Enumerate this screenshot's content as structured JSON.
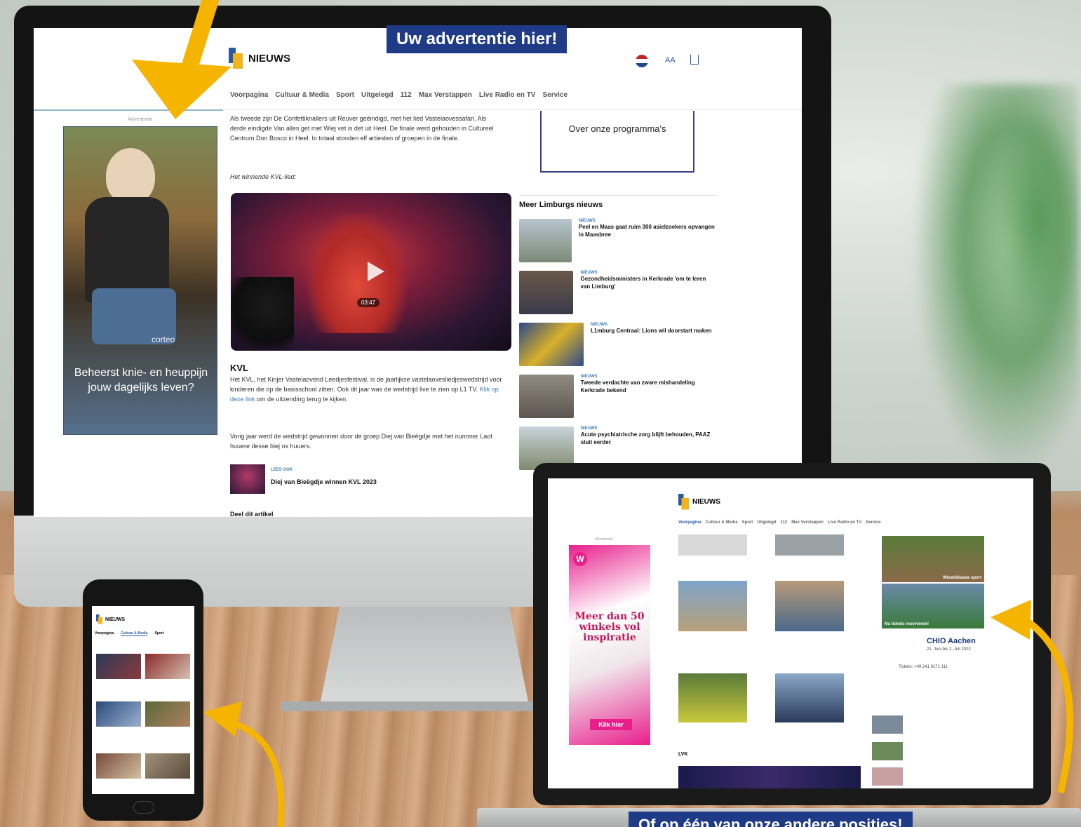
{
  "colors": {
    "accent_yellow": "#f5b400",
    "banner_blue": "#1f3a86",
    "logo_blue": "#2a58a6",
    "logo_yellow": "#f2b31b",
    "link_blue": "#3a7ab8"
  },
  "top_banner": {
    "label": "Uw advertentie hier!"
  },
  "bottom_banner": {
    "label": "Of op één van onze andere posities!"
  },
  "desktop": {
    "logo": "NIEUWS",
    "header_icons": [
      "flag-nl-icon",
      "text-size-icon",
      "share-icon"
    ],
    "text_size_label": "AA",
    "nav": [
      "Voorpagina",
      "Cultuur & Media",
      "Sport",
      "Uitgelegd",
      "112",
      "Max Verstappen",
      "Live Radio en TV",
      "Service"
    ],
    "ad_label": "Advertentie",
    "skyscraper": {
      "brand": "corteo",
      "headline": "Beheerst knie- en heuppijn jouw dagelijks leven?"
    },
    "article": {
      "para1": "Als tweede zijn De Confettiknallers uit Reuver geëindigd, met het lied Vastelaovessafari. Als derde eindigde Van alles get met Wiej vet is det uit Heel. De finale werd gehouden in Cultureel Centrum Don Bosco in Heel. In totaal stonden elf artiesten of groepen in de finale.",
      "caption": "Het winnende KVL-lied:",
      "video_duration": "03:47",
      "section_title": "KVL",
      "para2_a": "Het KVL, het Kinjer Vastelaovend Leedjesfestival, is de jaarlijkse vastelaovesliedjeswedstrijd voor kinderen die op de basisschool zitten. Ook dit jaar was de wedstrijd live te zien op L1 TV.",
      "para2_link": "Klik op deze link",
      "para2_b": "om de uitzending terug te kijken.",
      "para3": "Vorig jaar werd de wedstrijd gewonnen door de groep Diej van Bieëgdje met het nummer Laot huuere desse biej os huuers.",
      "read_also_label": "LEES OOK",
      "read_also_title": "Diej van Bieëgdje winnen KVL 2023",
      "share_label": "Deel dit artikel"
    },
    "programs_box": "Over onze programma's",
    "sidebar": {
      "title": "Meer Limburgs nieuws",
      "items": [
        {
          "tag": "NIEUWS",
          "title": "Peel en Maas gaat ruim 300 asielzoekers opvangen in Maasbree"
        },
        {
          "tag": "NIEUWS",
          "title": "Gezondheidsministers in Kerkrade 'om te leren van Limburg'"
        },
        {
          "tag": "NIEUWS",
          "title": "L1mburg Centraal: Lions wil doorstart maken"
        },
        {
          "tag": "NIEUWS",
          "title": "Tweede verdachte van zware mishandeling Kerkrade bekend"
        },
        {
          "tag": "NIEUWS",
          "title": "Acute psychiatrische zorg blijft behouden, PAAZ sluit eerder"
        }
      ]
    }
  },
  "laptop": {
    "logo": "NIEUWS",
    "nav": [
      "Voorpagina",
      "Cultuur & Media",
      "Sport",
      "Uitgelegd",
      "112",
      "Max Verstappen",
      "Live Radio en TV",
      "Service"
    ],
    "ad_label": "Advertentie",
    "ad": {
      "headline": "Meer dan 50 winkels vol inspiratie",
      "cta": "Klik hier"
    },
    "tiles": [
      "Wereldklasse sport",
      "Nu tickets reserveren!"
    ],
    "chio": {
      "title": "CHIO Aachen",
      "dates": "21. Juni bis 2. Juli 2023",
      "tickets": "Tickets: +49 241 9171 111"
    },
    "section": "LVK"
  },
  "phone": {
    "logo": "NIEUWS",
    "tabs": [
      "Voorpagina",
      "Cultuur & Media",
      "Sport"
    ]
  }
}
